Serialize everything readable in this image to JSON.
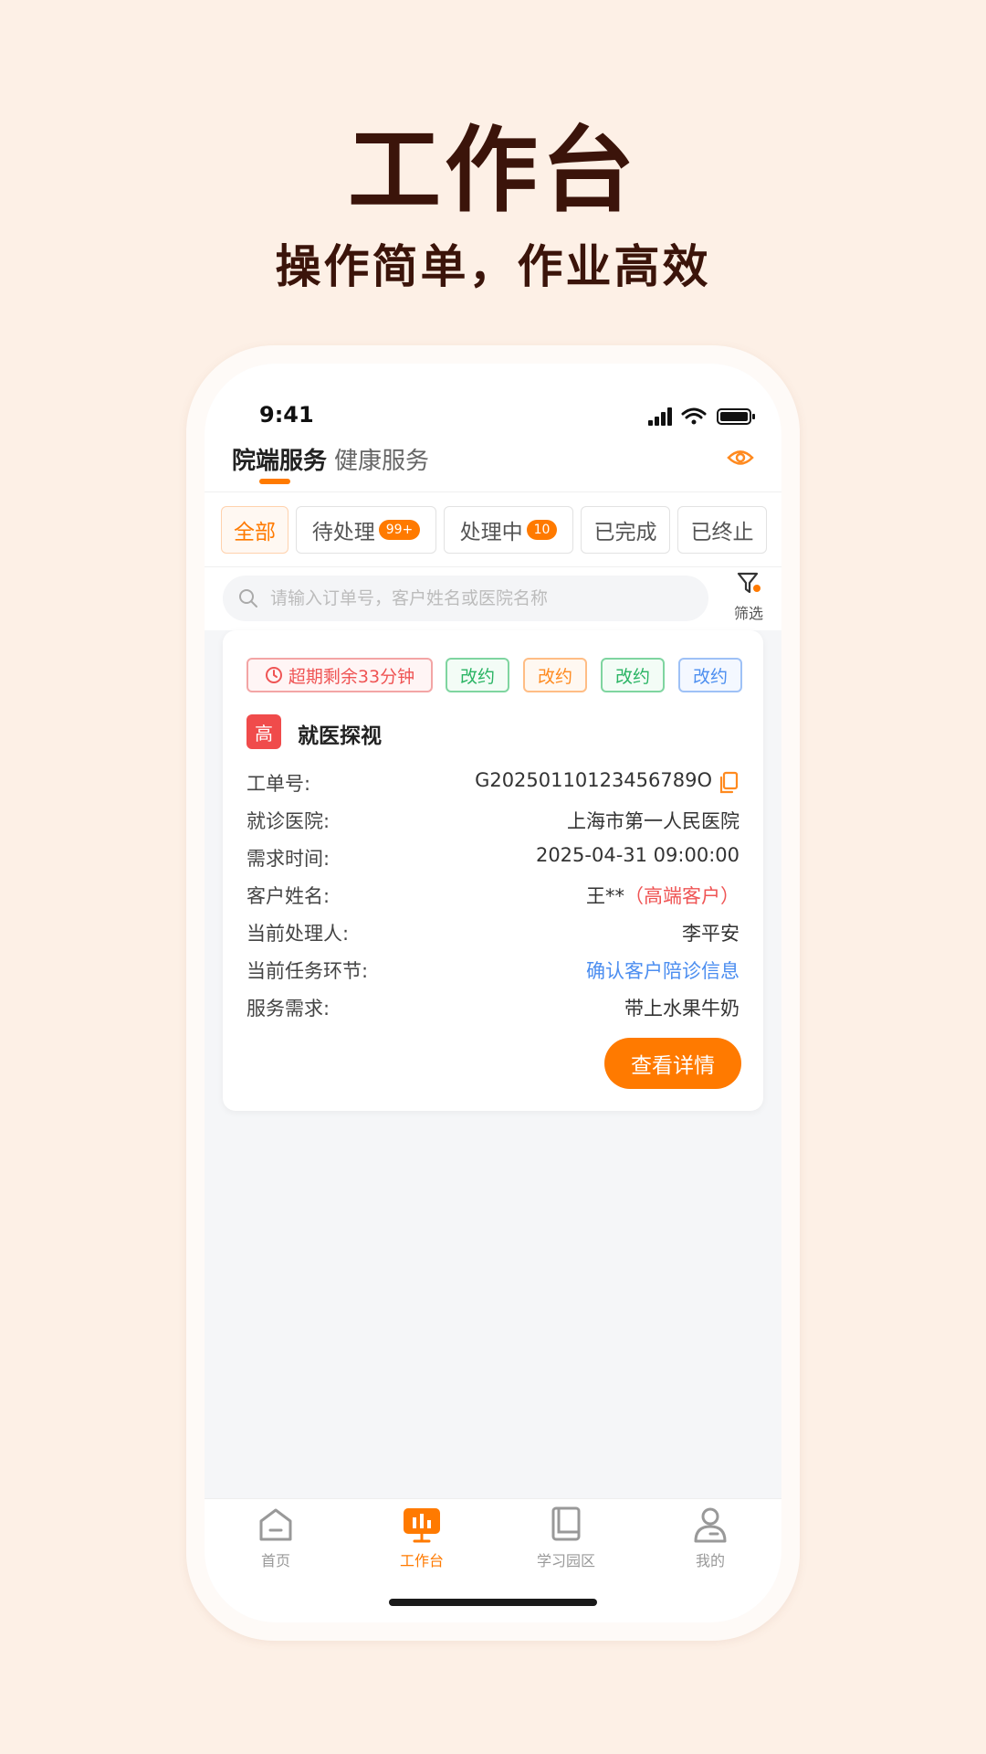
{
  "promo": {
    "title": "工作台",
    "subtitle": "操作简单，作业高效"
  },
  "status_bar": {
    "time": "9:41"
  },
  "tabs": [
    {
      "label": "院端服务",
      "active": true
    },
    {
      "label": "健康服务",
      "active": false
    }
  ],
  "icons": {
    "eye": "eye-icon",
    "search": "search-icon",
    "filter": "filter-icon",
    "clock": "clock-icon",
    "copy": "copy-icon"
  },
  "filters": [
    {
      "label": "全部",
      "active": true
    },
    {
      "label": "待处理",
      "badge": "99+"
    },
    {
      "label": "处理中",
      "badge": "10"
    },
    {
      "label": "已完成"
    },
    {
      "label": "已终止"
    }
  ],
  "search": {
    "placeholder": "请输入订单号，客户姓名或医院名称",
    "filter_label": "筛选"
  },
  "order": {
    "overdue_tag": "超期剩余33分钟",
    "tags": [
      "改约",
      "改约",
      "改约",
      "改约"
    ],
    "priority": "高",
    "title": "就医探视",
    "fields": [
      {
        "label": "工单号:",
        "value": "G20250110123456789O"
      },
      {
        "label": "就诊医院:",
        "value": "上海市第一人民医院"
      },
      {
        "label": "需求时间:",
        "value": "2025-04-31 09:00:00"
      },
      {
        "label": "客户姓名:",
        "value": "王**",
        "highlight": "（高端客户）"
      },
      {
        "label": "当前处理人:",
        "value": "李平安"
      },
      {
        "label": "当前任务环节:",
        "value": "确认客户陪诊信息"
      },
      {
        "label": "服务需求:",
        "value": "带上水果牛奶"
      }
    ],
    "detail_button": "查看详情"
  },
  "bottom_nav": [
    {
      "label": "首页",
      "icon": "home-icon"
    },
    {
      "label": "工作台",
      "icon": "workbench-icon",
      "active": true
    },
    {
      "label": "学习园区",
      "icon": "book-icon"
    },
    {
      "label": "我的",
      "icon": "user-icon"
    }
  ],
  "colors": {
    "accent": "#ff7a00",
    "background": "#fdf0e6",
    "headline": "#3b140a",
    "danger": "#ef5454",
    "success": "#29b463",
    "link": "#4c8ef0"
  }
}
